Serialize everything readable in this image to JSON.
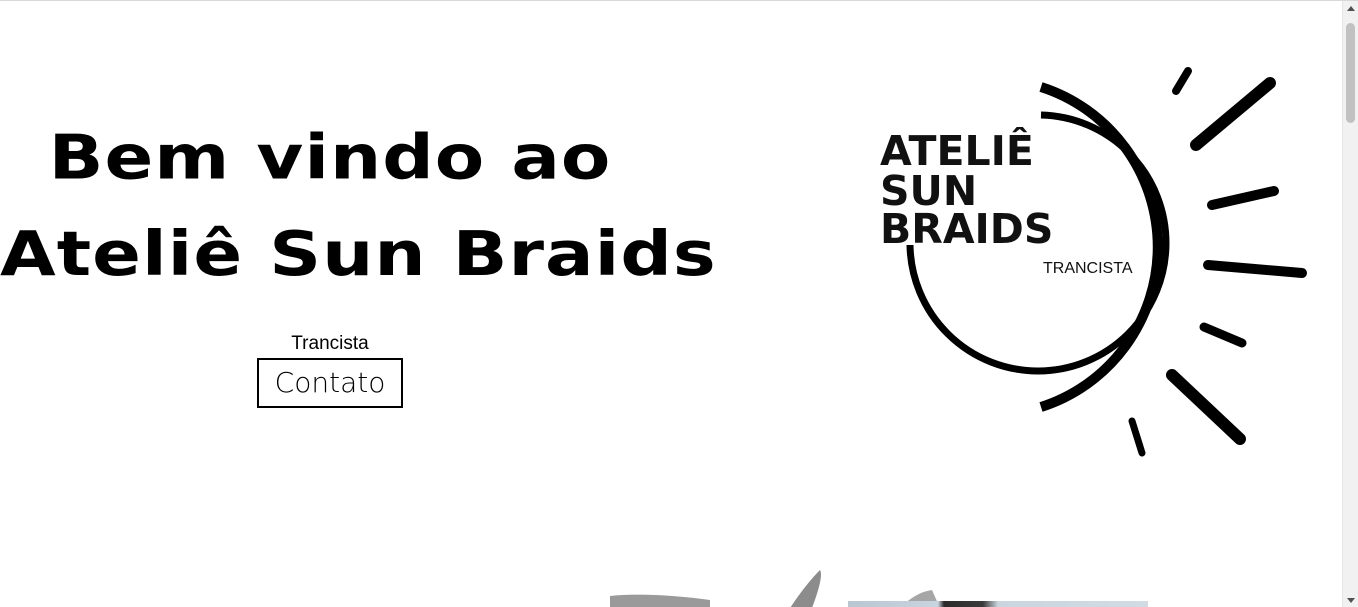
{
  "hero": {
    "title_line1": "Bem vindo ao",
    "title_line2": "Ateliê Sun Braids",
    "subtitle": "Trancista",
    "contact_label": "Contato"
  },
  "logo": {
    "line1": "ATELIÊ",
    "line2": "SUN",
    "line3": "BRAIDS",
    "tagline": "TRANCISTA",
    "icon": "sun-icon"
  },
  "colors": {
    "text": "#000000",
    "background": "#ffffff",
    "scrollbar_thumb": "#c1c1c1"
  }
}
